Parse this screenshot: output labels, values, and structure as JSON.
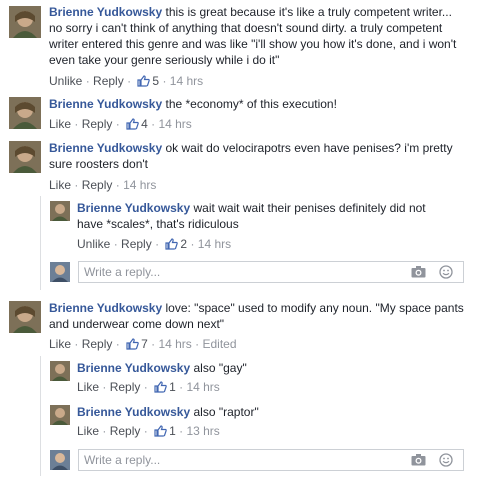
{
  "comments": [
    {
      "author": "Brienne Yudkowsky",
      "text_line1": "this is great because it's like a truly competent writer...",
      "text_line2": "no sorry i can't think of anything that doesn't sound dirty. a truly competent",
      "text_line3": "writer entered this genre and was like \"i'll show you how it's done, and i won't",
      "text_line4": "even take your genre seriously while i do it\"",
      "like_label": "Unlike",
      "reply_label": "Reply",
      "likes": "5",
      "time": "14 hrs"
    },
    {
      "author": "Brienne Yudkowsky",
      "text_line1": "the *economy* of this execution!",
      "like_label": "Like",
      "reply_label": "Reply",
      "likes": "4",
      "time": "14 hrs"
    },
    {
      "author": "Brienne Yudkowsky",
      "text_line1": "ok wait do velocirapotrs even have penises? i'm pretty",
      "text_line2": "sure roosters don't",
      "like_label": "Like",
      "reply_label": "Reply",
      "time": "14 hrs",
      "replies": [
        {
          "author": "Brienne Yudkowsky",
          "text_line1": "wait wait wait their penises definitely did not",
          "text_line2": "have *scales*, that's ridiculous",
          "like_label": "Unlike",
          "reply_label": "Reply",
          "likes": "2",
          "time": "14 hrs"
        }
      ],
      "reply_placeholder": "Write a reply..."
    },
    {
      "author": "Brienne Yudkowsky",
      "text_line1": "love: \"space\" used to modify any noun. \"My space pants",
      "text_line2": "and underwear come down next\"",
      "like_label": "Like",
      "reply_label": "Reply",
      "likes": "7",
      "time": "14 hrs",
      "edited": "Edited",
      "replies": [
        {
          "author": "Brienne Yudkowsky",
          "text_line1": "also \"gay\"",
          "like_label": "Like",
          "reply_label": "Reply",
          "likes": "1",
          "time": "14 hrs"
        },
        {
          "author": "Brienne Yudkowsky",
          "text_line1": "also \"raptor\"",
          "like_label": "Like",
          "reply_label": "Reply",
          "likes": "1",
          "time": "13 hrs"
        }
      ],
      "reply_placeholder": "Write a reply..."
    }
  ],
  "separator": "·",
  "colors": {
    "link": "#365899",
    "meta": "#90949c",
    "border": "#dddfe2"
  },
  "icons": {
    "like": "thumbs-up-icon",
    "camera": "camera-icon",
    "emoji": "emoji-icon"
  }
}
